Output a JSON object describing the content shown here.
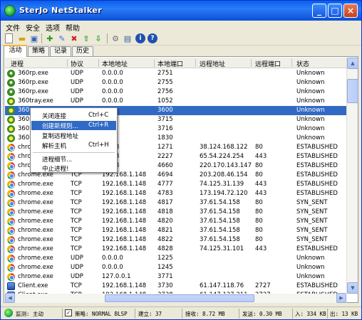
{
  "window": {
    "title": "SterJo NetStalker"
  },
  "menu": [
    "文件",
    "安全",
    "选项",
    "帮助"
  ],
  "toolbar": [
    "new-icon",
    "open-icon",
    "save-icon",
    "add-icon",
    "delete-icon",
    "up-icon",
    "down-icon",
    "settings-icon",
    "log-icon",
    "info-icon",
    "help-icon"
  ],
  "tabs": [
    "活动",
    "策略",
    "记录",
    "历史"
  ],
  "columns": [
    "进程",
    "协议",
    "本地地址",
    "本地端口",
    "远程地址",
    "远程端口",
    "状态"
  ],
  "rows": [
    {
      "icon": "360",
      "proc": "360rp.exe",
      "proto": "UDP",
      "laddr": "0.0.0.0",
      "lport": "2751",
      "raddr": "",
      "rport": "",
      "state": "Unknown"
    },
    {
      "icon": "360",
      "proc": "360rp.exe",
      "proto": "UDP",
      "laddr": "0.0.0.0",
      "lport": "2755",
      "raddr": "",
      "rport": "",
      "state": "Unknown"
    },
    {
      "icon": "360",
      "proc": "360rp.exe",
      "proto": "UDP",
      "laddr": "0.0.0.0",
      "lport": "2756",
      "raddr": "",
      "rport": "",
      "state": "Unknown"
    },
    {
      "icon": "tray",
      "proc": "360tray.exe",
      "proto": "UDP",
      "laddr": "0.0.0.0",
      "lport": "1052",
      "raddr": "",
      "rport": "",
      "state": "Unknown"
    },
    {
      "icon": "tray",
      "proc": "360",
      "proto": "",
      "laddr": "",
      "lport": "3600",
      "raddr": "",
      "rport": "",
      "state": "Unknown",
      "selected": true
    },
    {
      "icon": "tray",
      "proc": "360",
      "proto": "",
      "laddr": "",
      "lport": "3715",
      "raddr": "",
      "rport": "",
      "state": "Unknown"
    },
    {
      "icon": "tray",
      "proc": "360",
      "proto": "",
      "laddr": "",
      "lport": "3716",
      "raddr": "",
      "rport": "",
      "state": "Unknown"
    },
    {
      "icon": "tray",
      "proc": "360",
      "proto": "",
      "laddr": "0.1",
      "lport": "1830",
      "raddr": "",
      "rport": "",
      "state": "Unknown"
    },
    {
      "icon": "chrome",
      "proc": "chro",
      "proto": "",
      "laddr": "1.148",
      "lport": "1271",
      "raddr": "38.124.168.122",
      "rport": "80",
      "state": "ESTABLISHED"
    },
    {
      "icon": "chrome",
      "proc": "chro",
      "proto": "",
      "laddr": "1.148",
      "lport": "2227",
      "raddr": "65.54.224.254",
      "rport": "443",
      "state": "ESTABLISHED"
    },
    {
      "icon": "chrome",
      "proc": "chro",
      "proto": "",
      "laddr": "1.148",
      "lport": "4660",
      "raddr": "220.170.143.147",
      "rport": "80",
      "state": "ESTABLISHED"
    },
    {
      "icon": "chrome",
      "proc": "chrome.exe",
      "proto": "TCP",
      "laddr": "192.168.1.148",
      "lport": "4694",
      "raddr": "203.208.46.154",
      "rport": "80",
      "state": "ESTABLISHED"
    },
    {
      "icon": "chrome",
      "proc": "chrome.exe",
      "proto": "TCP",
      "laddr": "192.168.1.148",
      "lport": "4777",
      "raddr": "74.125.31.139",
      "rport": "443",
      "state": "ESTABLISHED"
    },
    {
      "icon": "chrome",
      "proc": "chrome.exe",
      "proto": "TCP",
      "laddr": "192.168.1.148",
      "lport": "4783",
      "raddr": "173.194.72.120",
      "rport": "443",
      "state": "ESTABLISHED"
    },
    {
      "icon": "chrome",
      "proc": "chrome.exe",
      "proto": "TCP",
      "laddr": "192.168.1.148",
      "lport": "4817",
      "raddr": "37.61.54.158",
      "rport": "80",
      "state": "SYN_SENT"
    },
    {
      "icon": "chrome",
      "proc": "chrome.exe",
      "proto": "TCP",
      "laddr": "192.168.1.148",
      "lport": "4818",
      "raddr": "37.61.54.158",
      "rport": "80",
      "state": "SYN_SENT"
    },
    {
      "icon": "chrome",
      "proc": "chrome.exe",
      "proto": "TCP",
      "laddr": "192.168.1.148",
      "lport": "4820",
      "raddr": "37.61.54.158",
      "rport": "80",
      "state": "SYN_SENT"
    },
    {
      "icon": "chrome",
      "proc": "chrome.exe",
      "proto": "TCP",
      "laddr": "192.168.1.148",
      "lport": "4821",
      "raddr": "37.61.54.158",
      "rport": "80",
      "state": "SYN_SENT"
    },
    {
      "icon": "chrome",
      "proc": "chrome.exe",
      "proto": "TCP",
      "laddr": "192.168.1.148",
      "lport": "4822",
      "raddr": "37.61.54.158",
      "rport": "80",
      "state": "SYN_SENT"
    },
    {
      "icon": "chrome",
      "proc": "chrome.exe",
      "proto": "TCP",
      "laddr": "192.168.1.148",
      "lport": "4828",
      "raddr": "74.125.31.101",
      "rport": "443",
      "state": "ESTABLISHED"
    },
    {
      "icon": "chrome",
      "proc": "chrome.exe",
      "proto": "UDP",
      "laddr": "0.0.0.0",
      "lport": "1225",
      "raddr": "",
      "rport": "",
      "state": "Unknown"
    },
    {
      "icon": "chrome",
      "proc": "chrome.exe",
      "proto": "UDP",
      "laddr": "0.0.0.0",
      "lport": "1245",
      "raddr": "",
      "rport": "",
      "state": "Unknown"
    },
    {
      "icon": "chrome",
      "proc": "chrome.exe",
      "proto": "UDP",
      "laddr": "127.0.0.1",
      "lport": "3771",
      "raddr": "",
      "rport": "",
      "state": "Unknown"
    },
    {
      "icon": "client",
      "proc": "Client.exe",
      "proto": "TCP",
      "laddr": "192.168.1.148",
      "lport": "3730",
      "raddr": "61.147.118.76",
      "rport": "2727",
      "state": "ESTABLISHED"
    },
    {
      "icon": "client",
      "proc": "Client.exe",
      "proto": "TCP",
      "laddr": "192.168.1.148",
      "lport": "3738",
      "raddr": "61.147.127.211",
      "rport": "2727",
      "state": "ESTABLISHED"
    }
  ],
  "context_menu": [
    {
      "label": "关闭连接",
      "shortcut": "Ctrl+C"
    },
    {
      "label": "创建新规则...",
      "shortcut": "Ctrl+R",
      "highlighted": true
    },
    {
      "label": "复制远程地址",
      "shortcut": ""
    },
    {
      "label": "解析主机",
      "shortcut": "Ctrl+H"
    },
    {
      "separator": true
    },
    {
      "label": "进程细节...",
      "shortcut": ""
    },
    {
      "label": "中止进程!",
      "shortcut": ""
    }
  ],
  "status": {
    "monitor": "监测: 主动",
    "policy": "策略: NORMAL BLSP",
    "established": "建立: 37",
    "received": "接收: 8.72 MB",
    "sent": "发送: 0.30 MB",
    "in_rate": "入: 334 KB",
    "out_rate": "出: 13 KB"
  },
  "colors": {
    "selection": "#316ac5",
    "titlebar": "#0a5fe8",
    "window_bg": "#ece9d8"
  }
}
